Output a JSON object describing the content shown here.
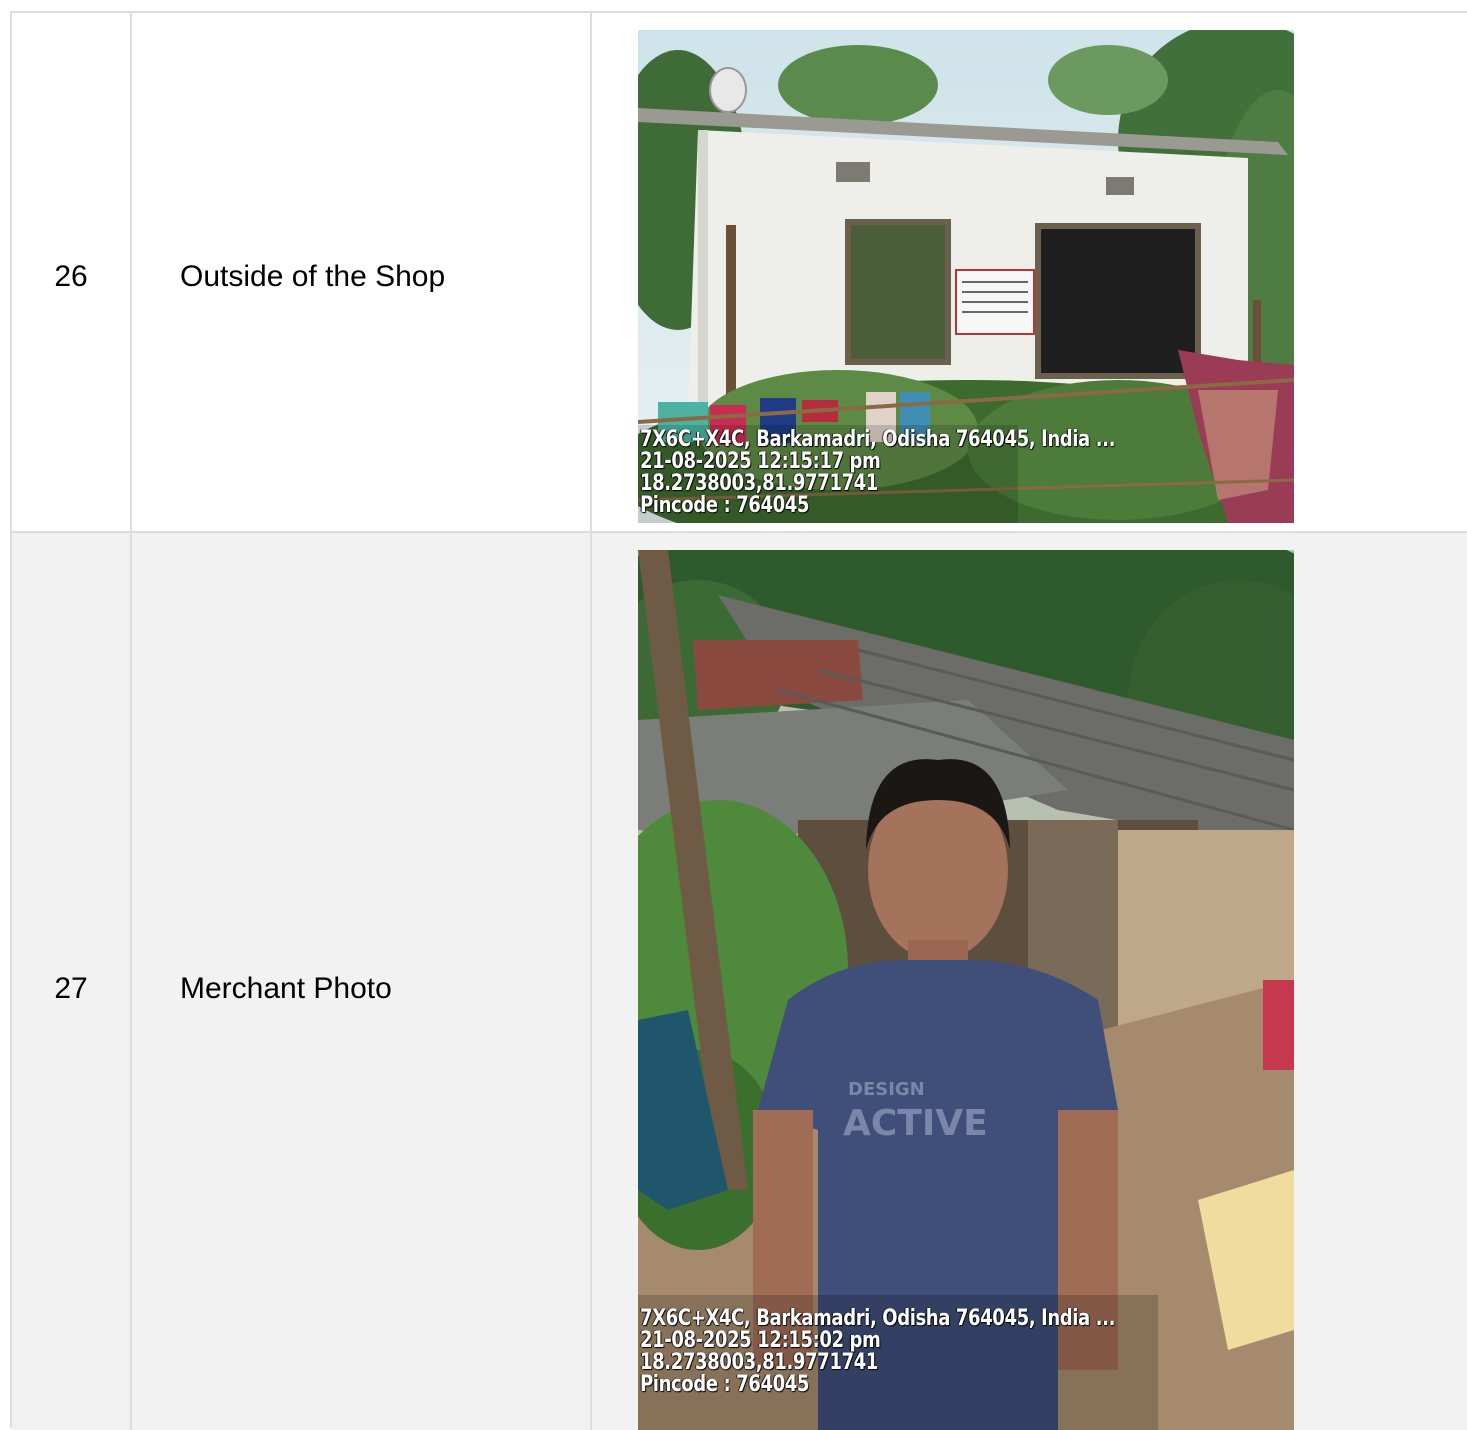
{
  "rows": [
    {
      "number": "26",
      "label": "Outside of the Shop",
      "photo": {
        "subject": "shop-building-photo",
        "stamp": {
          "address": "7X6C+X4C, Barkamadri, Odisha 764045, India ...",
          "datetime": "21-08-2025  12:15:17  pm",
          "coords": "18.2738003,81.9771741",
          "pincode": "Pincode :  764045"
        }
      }
    },
    {
      "number": "27",
      "label": "Merchant Photo",
      "photo": {
        "subject": "merchant-portrait-photo",
        "shirt_text_top": "DESIGN",
        "shirt_text_bottom": "ACTIVE",
        "stamp": {
          "address": "7X6C+X4C, Barkamadri, Odisha 764045, India ...",
          "datetime": "21-08-2025  12:15:02  pm",
          "coords": "18.2738003,81.9771741",
          "pincode": "Pincode :  764045"
        }
      }
    }
  ],
  "colors": {
    "border": "#dddddd",
    "row_alt_bg": "#f2f2f2",
    "text": "#000000"
  }
}
